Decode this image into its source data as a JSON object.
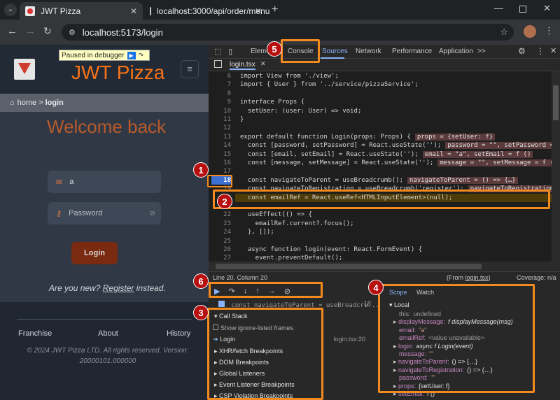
{
  "browser": {
    "tabs": [
      {
        "title": "JWT Pizza"
      },
      {
        "title": "localhost:3000/api/order/menu"
      }
    ],
    "url": "localhost:5173/login"
  },
  "app": {
    "debugger_banner": "Paused in debugger",
    "brand": "JWT Pizza",
    "breadcrumb": {
      "home": "home",
      "sep": ">",
      "current": "login"
    },
    "heading": "Welcome back",
    "email_value": "a",
    "password_placeholder": "Password",
    "login_button": "Login",
    "register_prefix": "Are you new?",
    "register_link": "Register",
    "register_suffix": "instead.",
    "footer_links": [
      "Franchise",
      "About",
      "History"
    ],
    "copyright": "© 2024 JWT Pizza LTD. All rights reserved. Version: 20000101.000000"
  },
  "devtools": {
    "tabs": [
      "Elem",
      "Console",
      "Sources",
      "Network",
      "Performance",
      "Application"
    ],
    "more": ">>",
    "file_tab": "login.tsx",
    "code": [
      {
        "n": "6",
        "t": "import View from './view';"
      },
      {
        "n": "7",
        "t": "import { User } from '../service/pizzaService';"
      },
      {
        "n": "8",
        "t": ""
      },
      {
        "n": "9",
        "t": "interface Props {"
      },
      {
        "n": "10",
        "t": "  setUser: (user: User) => void;"
      },
      {
        "n": "11",
        "t": "}"
      },
      {
        "n": "12",
        "t": ""
      },
      {
        "n": "13",
        "t": "export default function Login(props: Props) {",
        "inline": "props = {setUser: f}"
      },
      {
        "n": "14",
        "t": "  const [password, setPassword] = React.useState('');",
        "inline": "password = \"\", setPassword = f ()"
      },
      {
        "n": "15",
        "t": "  const [email, setEmail] = React.useState('');",
        "inline": "email = \"a\", setEmail = f ()"
      },
      {
        "n": "16",
        "t": "  const [message, setMessage] = React.useState('');",
        "inline": "message = \"\", setMessage = f ()"
      },
      {
        "n": "17",
        "t": ""
      },
      {
        "n": "18",
        "t": "  const navigateToParent = useBreadcrumb();",
        "inline": "navigateToParent = () => {…}"
      },
      {
        "n": "19",
        "t": "  const navigateToRegistration = useBreadcrumb('register');",
        "inline": "navigateToRegistration = () ="
      },
      {
        "n": "20",
        "t": "  const emailRef = React.useRef<HTMLInputElement>(null);"
      },
      {
        "n": "21",
        "t": ""
      },
      {
        "n": "22",
        "t": "  useEffect(() => {"
      },
      {
        "n": "23",
        "t": "    emailRef.current?.focus();"
      },
      {
        "n": "24",
        "t": "  }, []);"
      },
      {
        "n": "25",
        "t": ""
      },
      {
        "n": "26",
        "t": "  async function login(event: React.FormEvent) {"
      },
      {
        "n": "27",
        "t": "    event.preventDefault();"
      }
    ],
    "status_left": "Line 20, Column 20",
    "status_from_prefix": "(From ",
    "status_from_file": "login.tsx",
    "status_from_suffix": ")",
    "coverage": "Coverage: n/a",
    "breakpoint_line": "const navigateToParent = useBreadcru...",
    "breakpoint_num": "18",
    "call_stack_title": "Call Stack",
    "show_ignore": "Show ignore-listed frames",
    "frame_name": "Login",
    "frame_loc": "login.tsx:20",
    "sections": [
      "XHR/fetch Breakpoints",
      "DOM Breakpoints",
      "Global Listeners",
      "Event Listener Breakpoints",
      "CSP Violation Breakpoints"
    ],
    "scope_tabs": [
      "Scope",
      "Watch"
    ],
    "scope_local": "Local",
    "scope_vars": [
      {
        "k": "this:",
        "v": "undefined"
      },
      {
        "k": "displayMessage:",
        "v": "f displayMessage(msg)"
      },
      {
        "k": "email:",
        "v": "\"a\""
      },
      {
        "k": "emailRef:",
        "v": "<value unavailable>"
      },
      {
        "k": "login:",
        "v": "async f Login(event)"
      },
      {
        "k": "message:",
        "v": "\"\""
      },
      {
        "k": "navigateToParent:",
        "v": "() => {…}"
      },
      {
        "k": "navigateToRegistration:",
        "v": "() => {…}"
      },
      {
        "k": "password:",
        "v": "\"\""
      },
      {
        "k": "props:",
        "v": "{setUser: f}"
      },
      {
        "k": "setEmail:",
        "v": "f ()"
      }
    ]
  },
  "callouts": [
    "1",
    "2",
    "3",
    "4",
    "5",
    "6"
  ]
}
